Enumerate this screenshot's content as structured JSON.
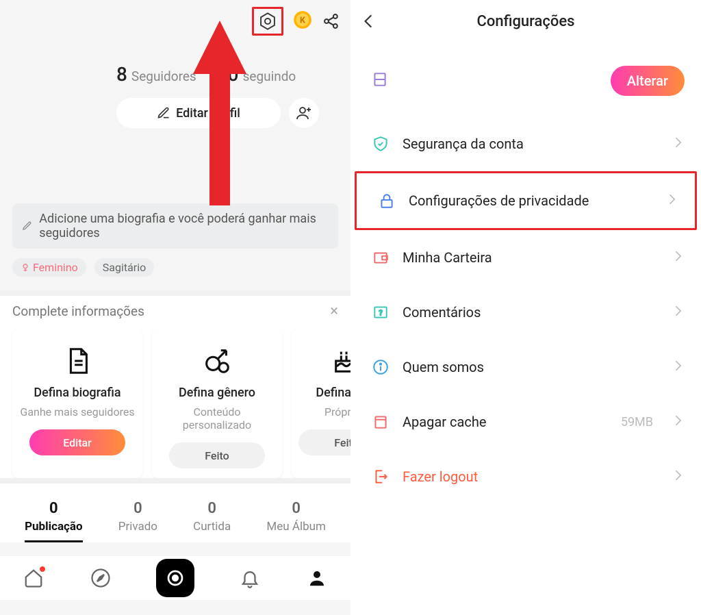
{
  "left": {
    "followers": {
      "count": "8",
      "label": "Seguidores"
    },
    "following": {
      "count": "10",
      "label": "seguindo"
    },
    "edit_profile_label": "Editar Perfil",
    "bio_prompt": "Adicione uma biografia e você poderá ganhar mais seguidores",
    "gender_tag": "Feminino",
    "zodiac_tag": "Sagitário",
    "complete_title": "Complete informações",
    "cards": [
      {
        "title": "Defina biografia",
        "sub": "Ganhe mais seguidores",
        "btn": "Editar"
      },
      {
        "title": "Defina gênero",
        "sub": "Conteúdo personalizado",
        "btn": "Feito"
      },
      {
        "title": "Defina aniv",
        "sub": "Próprio s",
        "btn": "Feito"
      }
    ],
    "tabs": [
      {
        "num": "0",
        "label": "Publicação"
      },
      {
        "num": "0",
        "label": "Privado"
      },
      {
        "num": "0",
        "label": "Curtida"
      },
      {
        "num": "0",
        "label": "Meu Álbum"
      }
    ]
  },
  "right": {
    "title": "Configurações",
    "alterar": "Alterar",
    "items": {
      "security": "Segurança da conta",
      "privacy": "Configurações de privacidade",
      "wallet": "Minha Carteira",
      "comments": "Comentários",
      "about": "Quem somos",
      "cache": "Apagar cache",
      "cache_size": "59MB",
      "logout": "Fazer logout"
    }
  }
}
